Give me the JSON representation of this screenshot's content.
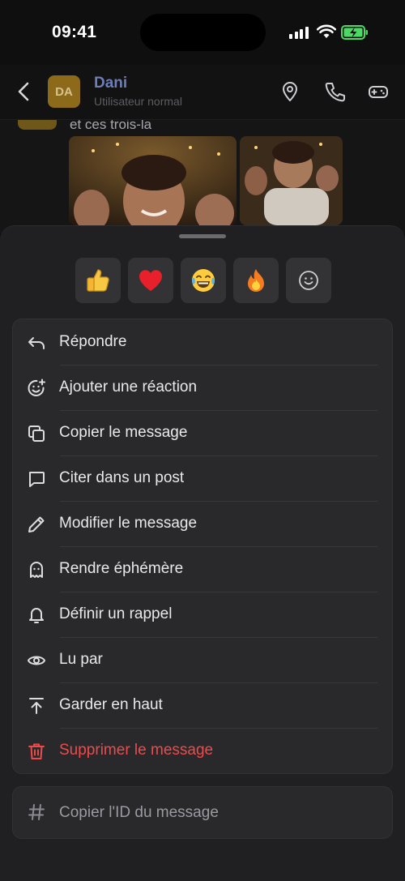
{
  "status_bar": {
    "time": "09:41"
  },
  "header": {
    "avatar_initials": "DA",
    "contact_name": "Dani",
    "contact_role": "Utilisateur normal",
    "icons": [
      "back-chevron-icon",
      "location-pin-icon",
      "phone-icon",
      "gamepad-icon"
    ]
  },
  "chat": {
    "message_text": "et ces trois-la"
  },
  "reactions": [
    {
      "emoji": "👍",
      "name": "thumbs-up"
    },
    {
      "emoji": "❤️",
      "name": "heart"
    },
    {
      "emoji": "😂",
      "name": "tears-of-joy"
    },
    {
      "emoji": "🔥",
      "name": "fire"
    },
    {
      "emoji": "☺",
      "name": "add-reaction"
    }
  ],
  "menu": {
    "items": [
      {
        "label": "Répondre",
        "icon": "reply-icon"
      },
      {
        "label": "Ajouter une réaction",
        "icon": "add-emoji-icon"
      },
      {
        "label": "Copier le message",
        "icon": "copy-icon"
      },
      {
        "label": "Citer dans un post",
        "icon": "quote-icon"
      },
      {
        "label": "Modifier le message",
        "icon": "pencil-icon"
      },
      {
        "label": "Rendre éphémère",
        "icon": "ghost-icon"
      },
      {
        "label": "Définir un rappel",
        "icon": "bell-icon"
      },
      {
        "label": "Lu par",
        "icon": "eye-icon"
      },
      {
        "label": "Garder en haut",
        "icon": "pin-top-icon"
      },
      {
        "label": "Supprimer le message",
        "icon": "trash-icon",
        "color": "#ef4a4a"
      }
    ],
    "secondary": {
      "label": "Copier l'ID du message",
      "icon": "hash-icon"
    }
  },
  "colors": {
    "background": "#0f0f10",
    "sheet": "#202023",
    "card": "#29292c",
    "contact_name": "#6d7fb6",
    "danger": "#ef4a4a",
    "battery": "#4cd964"
  }
}
